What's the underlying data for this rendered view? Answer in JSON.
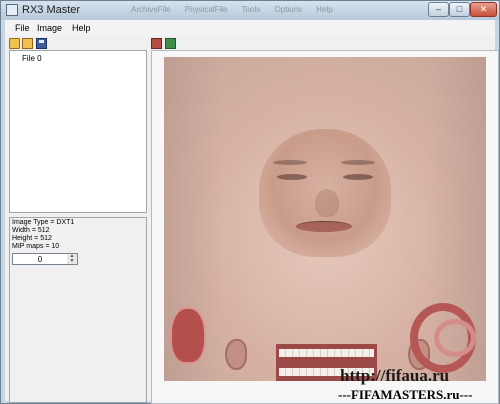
{
  "window": {
    "title": "RX3 Master",
    "ghost_menu": "ArchiveFile   PhysicalFile   Tools   Options   Help",
    "controls": {
      "minimize": "–",
      "maximize": "□",
      "close": "✕"
    }
  },
  "menu": {
    "file": "File",
    "image": "Image",
    "help": "Help"
  },
  "toolbar": {
    "icons": [
      "open-folder-icon",
      "open-folder-icon",
      "save-icon",
      "export-image-icon",
      "import-image-icon"
    ]
  },
  "tree": {
    "item": "File 0"
  },
  "info": {
    "image_type": "Image Type = DXT1",
    "width": "Width = 512",
    "height": "Height = 512",
    "mip_maps": "MIP maps = 10",
    "spinner_value": "0"
  },
  "watermark": {
    "url": "http://fifaua.ru",
    "site": "---FIFAMASTERS.ru---"
  }
}
